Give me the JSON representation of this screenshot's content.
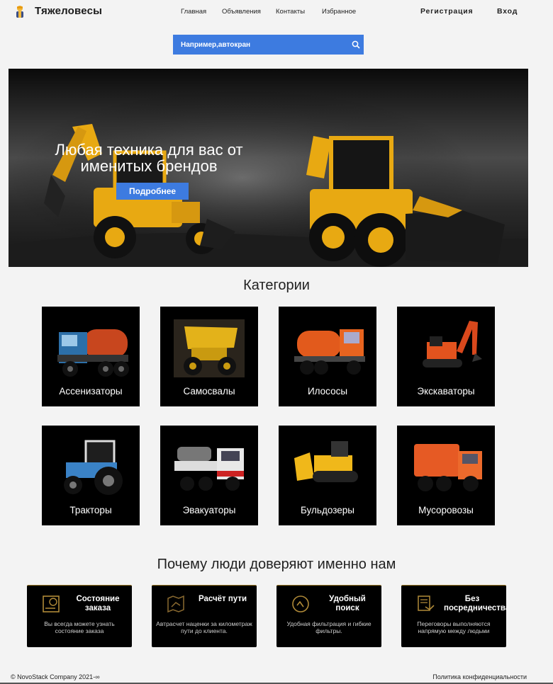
{
  "header": {
    "brand": "Тяжеловесы",
    "nav": [
      "Главная",
      "Объявления",
      "Контакты",
      "Избранное"
    ],
    "register": "Регистрация",
    "login": "Вход"
  },
  "search": {
    "placeholder": "Например,автокран"
  },
  "hero": {
    "title": "Любая техника для вас от именитых брендов",
    "button": "Подробнее"
  },
  "categories": {
    "title": "Категории",
    "items": [
      {
        "label": "Ассенизаторы",
        "icon": "tank-truck-icon"
      },
      {
        "label": "Самосвалы",
        "icon": "dump-truck-icon"
      },
      {
        "label": "Илососы",
        "icon": "vacuum-truck-icon"
      },
      {
        "label": "Экскаваторы",
        "icon": "excavator-icon"
      },
      {
        "label": "Тракторы",
        "icon": "tractor-icon"
      },
      {
        "label": "Эвакуаторы",
        "icon": "tow-truck-icon"
      },
      {
        "label": "Бульдозеры",
        "icon": "bulldozer-icon"
      },
      {
        "label": "Мусоровозы",
        "icon": "garbage-truck-icon"
      }
    ]
  },
  "why": {
    "title": "Почему люди доверяют именно нам",
    "items": [
      {
        "title": "Состояние заказа",
        "desc": "Вы всегда можете узнать состояние заказа",
        "icon": "order-status-icon"
      },
      {
        "title": "Расчёт пути",
        "desc": "Автрасчет наценки за километраж пути до клиента.",
        "icon": "route-map-icon"
      },
      {
        "title": "Удобный поиск",
        "desc": "Удобная фильтрация и гибкие фильтры.",
        "icon": "search-filter-icon"
      },
      {
        "title": "Без посредничества",
        "desc": "Переговоры выполняются напрямую между людьми",
        "icon": "direct-deal-icon"
      }
    ]
  },
  "footer": {
    "copyright": "© NovoStack Company 2021-∞",
    "policy": "Политика конфиденциальности"
  },
  "colors": {
    "accent": "#3d7be0",
    "machine_yellow": "#e8a912",
    "feature_border": "#9c7a28"
  }
}
